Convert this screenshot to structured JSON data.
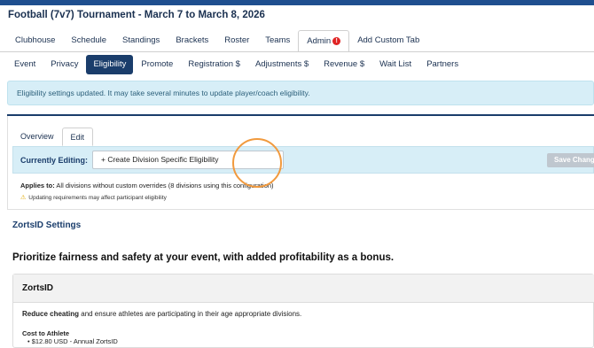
{
  "event": {
    "title": "Football (7v7) Tournament  -  March 7 to March 8, 2026"
  },
  "main_tabs": [
    {
      "label": "Clubhouse"
    },
    {
      "label": "Schedule"
    },
    {
      "label": "Standings"
    },
    {
      "label": "Brackets"
    },
    {
      "label": "Roster"
    },
    {
      "label": "Teams"
    },
    {
      "label": "Admin",
      "badge": "!"
    },
    {
      "label": "Add Custom Tab"
    }
  ],
  "admin_tabs": [
    {
      "label": "Event"
    },
    {
      "label": "Privacy"
    },
    {
      "label": "Eligibility"
    },
    {
      "label": "Promote"
    },
    {
      "label": "Registration $"
    },
    {
      "label": "Adjustments $"
    },
    {
      "label": "Revenue $"
    },
    {
      "label": "Wait List"
    },
    {
      "label": "Partners"
    }
  ],
  "alert": {
    "text": "Eligibility settings updated. It may take several minutes to update player/coach eligibility."
  },
  "sub_tabs": [
    {
      "label": "Overview"
    },
    {
      "label": "Edit"
    }
  ],
  "editing": {
    "label": "Currently Editing:",
    "select_value": "+ Create Division Specific Eligibility",
    "save_label": "Save Changes"
  },
  "applies": {
    "label": "Applies to:",
    "text": " All divisions without custom overrides (8 divisions using this configuration)"
  },
  "warning": {
    "icon": "warning-icon",
    "text": "Updating requirements may affect participant eligibility"
  },
  "zortsid": {
    "heading": "ZortsID Settings",
    "headline": "Prioritize fairness and safety at your event, with added profitability as a bonus.",
    "card_title": "ZortsID",
    "reduce_bold": "Reduce cheating",
    "reduce_rest": " and ensure athletes are participating in their age appropriate divisions.",
    "cost_label": "Cost to Athlete",
    "cost_item": "$12.80 USD - Annual ZortsID"
  },
  "colors": {
    "navy": "#1a3d6b",
    "alert_bg": "#d7eef7",
    "badge": "#e02424",
    "highlight_circle": "#f19a3e",
    "save_disabled": "#bfc7cf"
  }
}
